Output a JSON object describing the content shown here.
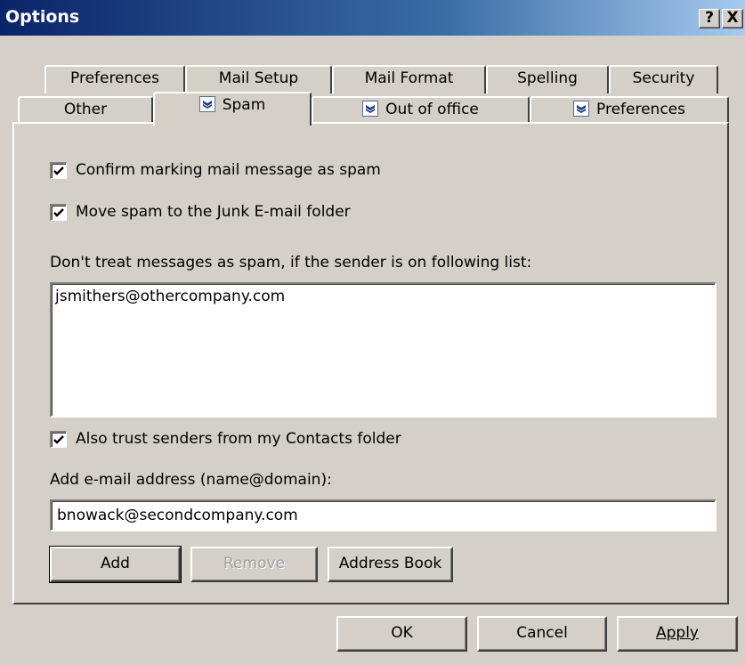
{
  "window": {
    "title": "Options",
    "help_glyph": "?",
    "close_glyph": "X"
  },
  "tabs": {
    "row1": [
      "Preferences",
      "Mail Setup",
      "Mail Format",
      "Spelling",
      "Security"
    ],
    "row2": [
      "Other",
      "Spam",
      "Out of office",
      "Preferences"
    ],
    "selected": "Spam"
  },
  "spam": {
    "confirm_marking": {
      "label": "Confirm marking mail message as spam",
      "checked": true
    },
    "move_to_junk": {
      "label": "Move spam to the Junk E-mail folder",
      "checked": true
    },
    "safe_list_label": "Don't treat messages as spam, if the sender is on following list:",
    "safe_list": [
      "jsmithers@othercompany.com"
    ],
    "trust_contacts": {
      "label": "Also trust senders from my Contacts folder",
      "checked": true
    },
    "add_address_label": "Add e-mail address (name@domain):",
    "add_address_value": "bnowack@secondcompany.com",
    "add_button": "Add",
    "remove_button": "Remove",
    "address_book_button": "Address Book"
  },
  "footer": {
    "ok": "OK",
    "cancel": "Cancel",
    "apply": "Apply"
  }
}
